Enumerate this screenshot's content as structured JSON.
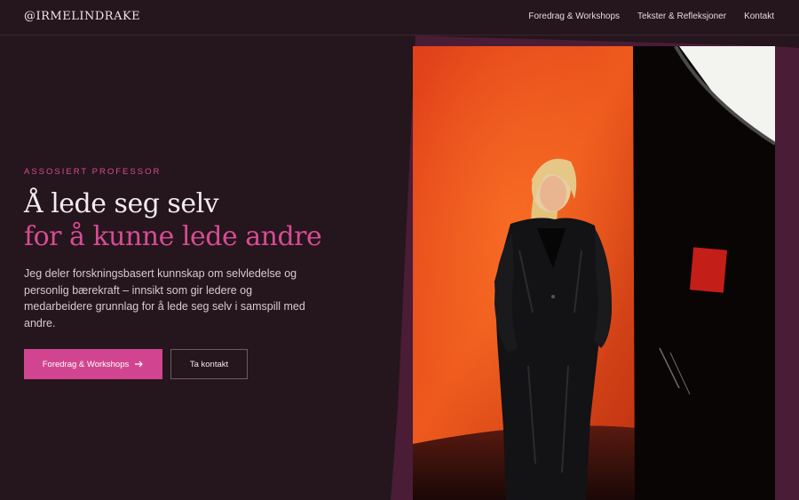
{
  "header": {
    "brand": "@IRMELINDRAKE",
    "nav": [
      "Foredrag & Workshops",
      "Tekster & Refleksjoner",
      "Kontakt"
    ]
  },
  "hero": {
    "eyebrow": "ASSOSIERT PROFESSOR",
    "title_line1": "Å lede seg selv",
    "title_line2": "for å kunne lede andre",
    "lead": "Jeg deler forskningsbasert kunnskap om selvledelse og personlig bærekraft – innsikt som gir ledere og medarbeidere grunnlag for å lede seg selv i samspill med andre.",
    "primary_button": "Foredrag & Workshops",
    "secondary_button": "Ta kontakt"
  },
  "colors": {
    "background": "#25151c",
    "accent": "#d64c93",
    "backdrop": "#4a1c36"
  },
  "icons": {
    "button_arrow": "arrow-right-icon"
  }
}
